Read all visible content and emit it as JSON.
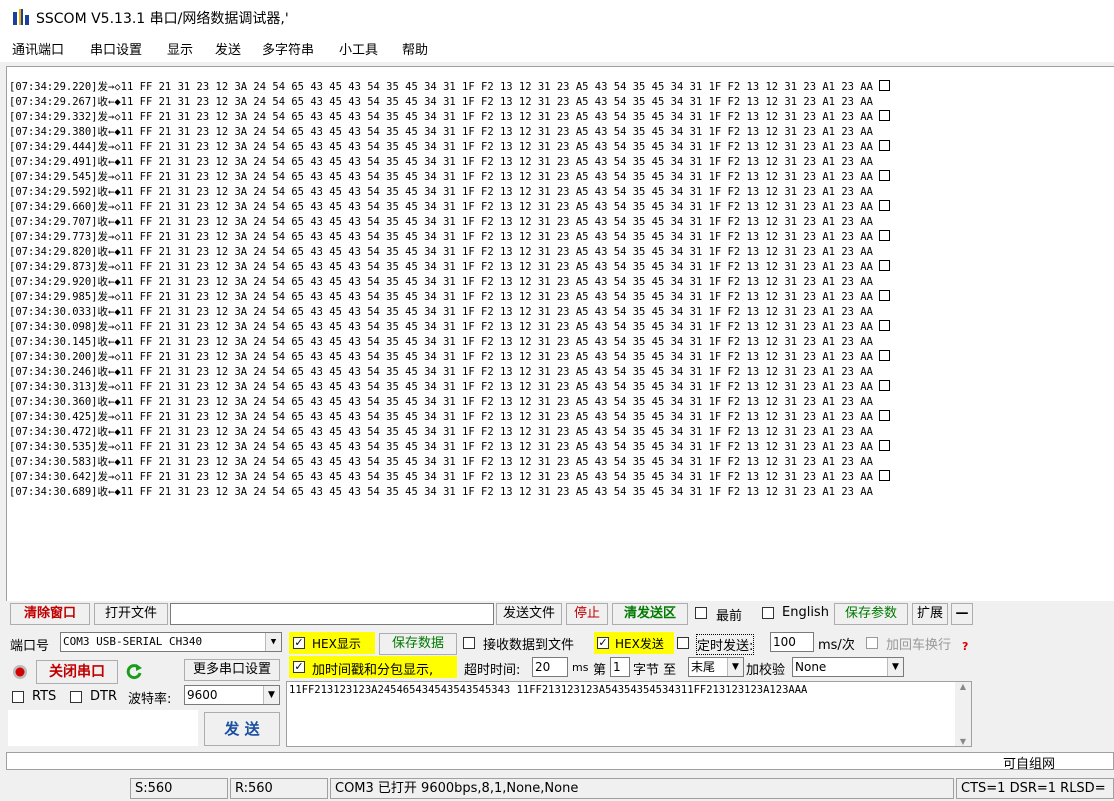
{
  "window": {
    "title": "SSCOM V5.13.1 串口/网络数据调试器,'"
  },
  "menu": [
    "通讯端口",
    "串口设置",
    "显示",
    "发送",
    "多字符串",
    "小工具",
    "帮助"
  ],
  "log": {
    "lines": [
      {
        "ts": "[07:34:29.220]",
        "dir": "发→◇",
        "data": "11 FF 21 31 23 12 3A 24 54 65 43 45 43 54 35 45 34 31 1F F2 13 12 31 23 A5 43 54 35 45 34 31 1F F2 13 12 31 23 A1 23 AA",
        "box": true
      },
      {
        "ts": "[07:34:29.267]",
        "dir": "收←◆",
        "data": "11 FF 21 31 23 12 3A 24 54 65 43 45 43 54 35 45 34 31 1F F2 13 12 31 23 A5 43 54 35 45 34 31 1F F2 13 12 31 23 A1 23 AA",
        "box": false
      },
      {
        "ts": "[07:34:29.332]",
        "dir": "发→◇",
        "data": "11 FF 21 31 23 12 3A 24 54 65 43 45 43 54 35 45 34 31 1F F2 13 12 31 23 A5 43 54 35 45 34 31 1F F2 13 12 31 23 A1 23 AA",
        "box": true
      },
      {
        "ts": "[07:34:29.380]",
        "dir": "收←◆",
        "data": "11 FF 21 31 23 12 3A 24 54 65 43 45 43 54 35 45 34 31 1F F2 13 12 31 23 A5 43 54 35 45 34 31 1F F2 13 12 31 23 A1 23 AA",
        "box": false
      },
      {
        "ts": "[07:34:29.444]",
        "dir": "发→◇",
        "data": "11 FF 21 31 23 12 3A 24 54 65 43 45 43 54 35 45 34 31 1F F2 13 12 31 23 A5 43 54 35 45 34 31 1F F2 13 12 31 23 A1 23 AA",
        "box": true
      },
      {
        "ts": "[07:34:29.491]",
        "dir": "收←◆",
        "data": "11 FF 21 31 23 12 3A 24 54 65 43 45 43 54 35 45 34 31 1F F2 13 12 31 23 A5 43 54 35 45 34 31 1F F2 13 12 31 23 A1 23 AA",
        "box": false
      },
      {
        "ts": "[07:34:29.545]",
        "dir": "发→◇",
        "data": "11 FF 21 31 23 12 3A 24 54 65 43 45 43 54 35 45 34 31 1F F2 13 12 31 23 A5 43 54 35 45 34 31 1F F2 13 12 31 23 A1 23 AA",
        "box": true
      },
      {
        "ts": "[07:34:29.592]",
        "dir": "收←◆",
        "data": "11 FF 21 31 23 12 3A 24 54 65 43 45 43 54 35 45 34 31 1F F2 13 12 31 23 A5 43 54 35 45 34 31 1F F2 13 12 31 23 A1 23 AA",
        "box": false
      },
      {
        "ts": "[07:34:29.660]",
        "dir": "发→◇",
        "data": "11 FF 21 31 23 12 3A 24 54 65 43 45 43 54 35 45 34 31 1F F2 13 12 31 23 A5 43 54 35 45 34 31 1F F2 13 12 31 23 A1 23 AA",
        "box": true
      },
      {
        "ts": "[07:34:29.707]",
        "dir": "收←◆",
        "data": "11 FF 21 31 23 12 3A 24 54 65 43 45 43 54 35 45 34 31 1F F2 13 12 31 23 A5 43 54 35 45 34 31 1F F2 13 12 31 23 A1 23 AA",
        "box": false
      },
      {
        "ts": "[07:34:29.773]",
        "dir": "发→◇",
        "data": "11 FF 21 31 23 12 3A 24 54 65 43 45 43 54 35 45 34 31 1F F2 13 12 31 23 A5 43 54 35 45 34 31 1F F2 13 12 31 23 A1 23 AA",
        "box": true
      },
      {
        "ts": "[07:34:29.820]",
        "dir": "收←◆",
        "data": "11 FF 21 31 23 12 3A 24 54 65 43 45 43 54 35 45 34 31 1F F2 13 12 31 23 A5 43 54 35 45 34 31 1F F2 13 12 31 23 A1 23 AA",
        "box": false
      },
      {
        "ts": "[07:34:29.873]",
        "dir": "发→◇",
        "data": "11 FF 21 31 23 12 3A 24 54 65 43 45 43 54 35 45 34 31 1F F2 13 12 31 23 A5 43 54 35 45 34 31 1F F2 13 12 31 23 A1 23 AA",
        "box": true
      },
      {
        "ts": "[07:34:29.920]",
        "dir": "收←◆",
        "data": "11 FF 21 31 23 12 3A 24 54 65 43 45 43 54 35 45 34 31 1F F2 13 12 31 23 A5 43 54 35 45 34 31 1F F2 13 12 31 23 A1 23 AA",
        "box": false
      },
      {
        "ts": "[07:34:29.985]",
        "dir": "发→◇",
        "data": "11 FF 21 31 23 12 3A 24 54 65 43 45 43 54 35 45 34 31 1F F2 13 12 31 23 A5 43 54 35 45 34 31 1F F2 13 12 31 23 A1 23 AA",
        "box": true
      },
      {
        "ts": "[07:34:30.033]",
        "dir": "收←◆",
        "data": "11 FF 21 31 23 12 3A 24 54 65 43 45 43 54 35 45 34 31 1F F2 13 12 31 23 A5 43 54 35 45 34 31 1F F2 13 12 31 23 A1 23 AA",
        "box": false
      },
      {
        "ts": "[07:34:30.098]",
        "dir": "发→◇",
        "data": "11 FF 21 31 23 12 3A 24 54 65 43 45 43 54 35 45 34 31 1F F2 13 12 31 23 A5 43 54 35 45 34 31 1F F2 13 12 31 23 A1 23 AA",
        "box": true
      },
      {
        "ts": "[07:34:30.145]",
        "dir": "收←◆",
        "data": "11 FF 21 31 23 12 3A 24 54 65 43 45 43 54 35 45 34 31 1F F2 13 12 31 23 A5 43 54 35 45 34 31 1F F2 13 12 31 23 A1 23 AA",
        "box": false
      },
      {
        "ts": "[07:34:30.200]",
        "dir": "发→◇",
        "data": "11 FF 21 31 23 12 3A 24 54 65 43 45 43 54 35 45 34 31 1F F2 13 12 31 23 A5 43 54 35 45 34 31 1F F2 13 12 31 23 A1 23 AA",
        "box": true
      },
      {
        "ts": "[07:34:30.246]",
        "dir": "收←◆",
        "data": "11 FF 21 31 23 12 3A 24 54 65 43 45 43 54 35 45 34 31 1F F2 13 12 31 23 A5 43 54 35 45 34 31 1F F2 13 12 31 23 A1 23 AA",
        "box": false
      },
      {
        "ts": "[07:34:30.313]",
        "dir": "发→◇",
        "data": "11 FF 21 31 23 12 3A 24 54 65 43 45 43 54 35 45 34 31 1F F2 13 12 31 23 A5 43 54 35 45 34 31 1F F2 13 12 31 23 A1 23 AA",
        "box": true
      },
      {
        "ts": "[07:34:30.360]",
        "dir": "收←◆",
        "data": "11 FF 21 31 23 12 3A 24 54 65 43 45 43 54 35 45 34 31 1F F2 13 12 31 23 A5 43 54 35 45 34 31 1F F2 13 12 31 23 A1 23 AA",
        "box": false
      },
      {
        "ts": "[07:34:30.425]",
        "dir": "发→◇",
        "data": "11 FF 21 31 23 12 3A 24 54 65 43 45 43 54 35 45 34 31 1F F2 13 12 31 23 A5 43 54 35 45 34 31 1F F2 13 12 31 23 A1 23 AA",
        "box": true
      },
      {
        "ts": "[07:34:30.472]",
        "dir": "收←◆",
        "data": "11 FF 21 31 23 12 3A 24 54 65 43 45 43 54 35 45 34 31 1F F2 13 12 31 23 A5 43 54 35 45 34 31 1F F2 13 12 31 23 A1 23 AA",
        "box": false
      },
      {
        "ts": "[07:34:30.535]",
        "dir": "发→◇",
        "data": "11 FF 21 31 23 12 3A 24 54 65 43 45 43 54 35 45 34 31 1F F2 13 12 31 23 A5 43 54 35 45 34 31 1F F2 13 12 31 23 A1 23 AA",
        "box": true
      },
      {
        "ts": "[07:34:30.583]",
        "dir": "收←◆",
        "data": "11 FF 21 31 23 12 3A 24 54 65 43 45 43 54 35 45 34 31 1F F2 13 12 31 23 A5 43 54 35 45 34 31 1F F2 13 12 31 23 A1 23 AA",
        "box": false
      },
      {
        "ts": "[07:34:30.642]",
        "dir": "发→◇",
        "data": "11 FF 21 31 23 12 3A 24 54 65 43 45 43 54 35 45 34 31 1F F2 13 12 31 23 A5 43 54 35 45 34 31 1F F2 13 12 31 23 A1 23 AA",
        "box": true
      },
      {
        "ts": "[07:34:30.689]",
        "dir": "收←◆",
        "data": "11 FF 21 31 23 12 3A 24 54 65 43 45 43 54 35 45 34 31 1F F2 13 12 31 23 A5 43 54 35 45 34 31 1F F2 13 12 31 23 A1 23 AA",
        "box": false
      }
    ]
  },
  "toolbar": {
    "clear": "清除窗口",
    "open_file": "打开文件",
    "file_path": "",
    "send_file": "发送文件",
    "stop": "停止",
    "clear_send": "清发送区",
    "topmost": "最前",
    "english": "English",
    "save_params": "保存参数",
    "expand": "扩展",
    "collapse": "—"
  },
  "port": {
    "port_label": "端口号",
    "port_value": "COM3 USB-SERIAL CH340",
    "close_port": "关闭串口",
    "more_settings": "更多串口设置",
    "rts": "RTS",
    "dtr": "DTR",
    "baud_label": "波特率:",
    "baud_value": "9600",
    "send": "发  送"
  },
  "options": {
    "hex_display": "HEX显示",
    "save_data": "保存数据",
    "recv_to_file": "接收数据到文件",
    "hex_send": "HEX发送",
    "timed_send": "定时发送:",
    "interval": "100",
    "interval_unit": "ms/次",
    "append_crlf": "加回车换行",
    "timestamp": "加时间戳和分包显示,",
    "timeout_label": "超时时间:",
    "timeout": "20",
    "ms": "ms",
    "byte_label": "第",
    "byte_value": "1",
    "byte_to": "字节 至",
    "end_value": "末尾",
    "checksum_label": "加校验",
    "checksum_value": "None"
  },
  "send_area": {
    "text": "11FF213123123A245465434543543545343 11FF213123123A54354354534311FF213123123A123AAA"
  },
  "ticker": {
    "tail": "可自组网"
  },
  "status": {
    "sent": "S:560",
    "received": "R:560",
    "port_status": "COM3 已打开  9600bps,8,1,None,None",
    "lines": "CTS=1 DSR=1 RLSD="
  }
}
